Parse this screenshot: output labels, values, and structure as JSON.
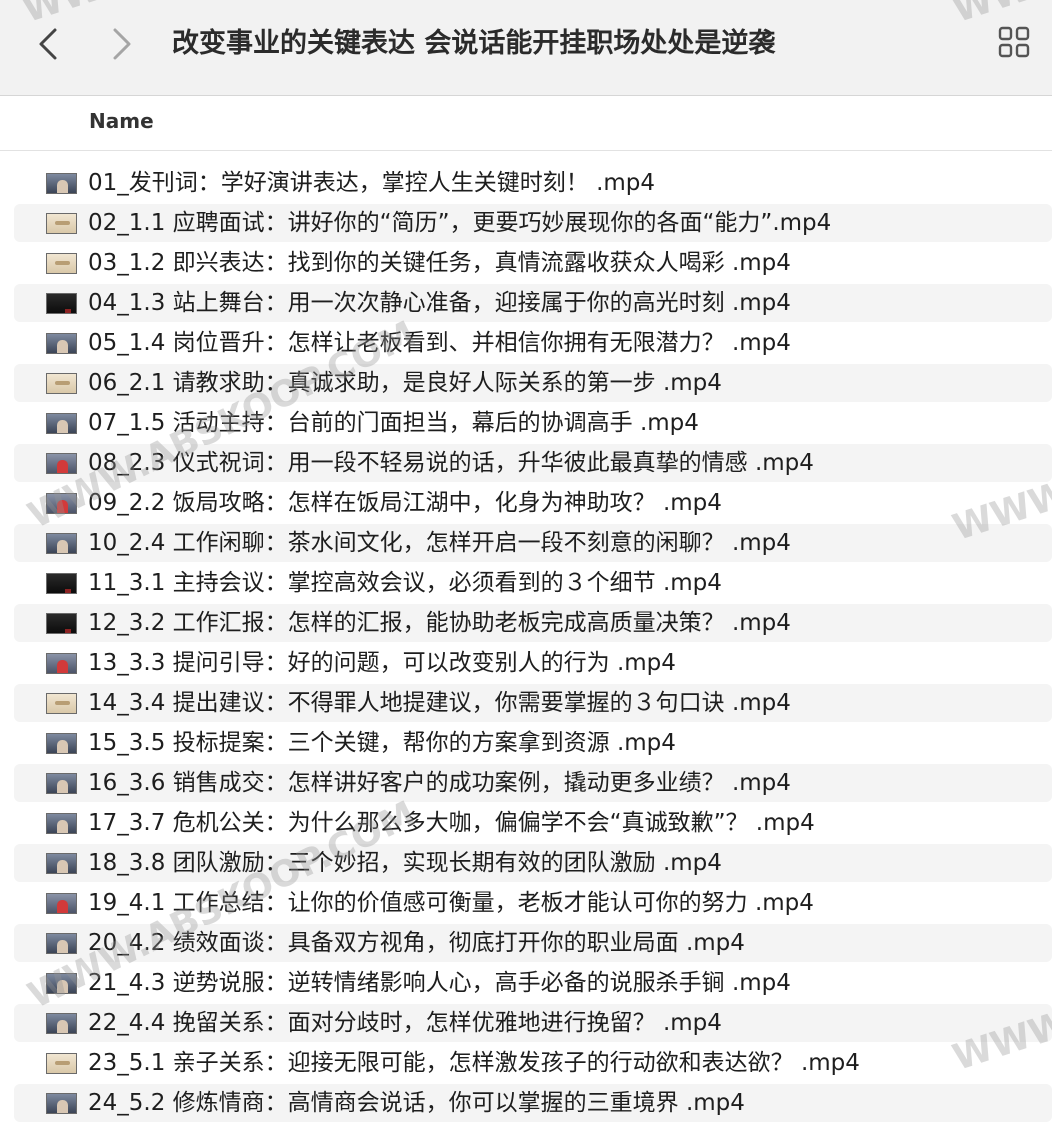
{
  "window": {
    "title": "改变事业的关键表达 会说话能开挂职场处处是逆袭"
  },
  "icons": {
    "back": "chevron-left-icon",
    "forward": "chevron-right-icon",
    "view": "grid-view-icon"
  },
  "columns": {
    "name": "Name"
  },
  "files": [
    {
      "name": "01_发刊词：学好演讲表达，掌控人生关键时刻！ .mp4",
      "thumb": "person"
    },
    {
      "name": "02_1.1 应聘面试：讲好你的“简历”，更要巧妙展现你的各面“能力”.mp4",
      "thumb": "paper"
    },
    {
      "name": "03_1.2 即兴表达：找到你的关键任务，真情流露收获众人喝彩 .mp4",
      "thumb": "paper"
    },
    {
      "name": "04_1.3 站上舞台：用一次次静心准备，迎接属于你的高光时刻 .mp4",
      "thumb": "dark"
    },
    {
      "name": "05_1.4 岗位晋升：怎样让老板看到、并相信你拥有无限潜力？ .mp4",
      "thumb": "person"
    },
    {
      "name": "06_2.1 请教求助：真诚求助，是良好人际关系的第一步 .mp4",
      "thumb": "paper"
    },
    {
      "name": "07_1.5 活动主持：台前的门面担当，幕后的协调高手 .mp4",
      "thumb": "person"
    },
    {
      "name": "08_2.3 仪式祝词：用一段不轻易说的话，升华彼此最真挚的情感 .mp4",
      "thumb": "red"
    },
    {
      "name": "09_2.2 饭局攻略：怎样在饭局江湖中，化身为神助攻？ .mp4",
      "thumb": "red"
    },
    {
      "name": "10_2.4 工作闲聊：茶水间文化，怎样开启一段不刻意的闲聊？ .mp4",
      "thumb": "person"
    },
    {
      "name": "11_3.1 主持会议：掌控高效会议，必须看到的３个细节 .mp4",
      "thumb": "dark"
    },
    {
      "name": "12_3.2 工作汇报：怎样的汇报，能协助老板完成高质量决策？ .mp4",
      "thumb": "dark"
    },
    {
      "name": "13_3.3 提问引导：好的问题，可以改变别人的行为 .mp4",
      "thumb": "red"
    },
    {
      "name": "14_3.4 提出建议：不得罪人地提建议，你需要掌握的３句口诀 .mp4",
      "thumb": "paper"
    },
    {
      "name": "15_3.5 投标提案：三个关键，帮你的方案拿到资源 .mp4",
      "thumb": "person"
    },
    {
      "name": "16_3.6 销售成交：怎样讲好客户的成功案例，撬动更多业绩？ .mp4",
      "thumb": "person"
    },
    {
      "name": "17_3.7 危机公关：为什么那么多大咖，偏偏学不会“真诚致歉”？ .mp4",
      "thumb": "person"
    },
    {
      "name": "18_3.8 团队激励：三个妙招，实现长期有效的团队激励 .mp4",
      "thumb": "person"
    },
    {
      "name": "19_4.1 工作总结：让你的价值感可衡量，老板才能认可你的努力 .mp4",
      "thumb": "red"
    },
    {
      "name": "20_4.2 绩效面谈：具备双方视角，彻底打开你的职业局面 .mp4",
      "thumb": "person"
    },
    {
      "name": "21_4.3 逆势说服：逆转情绪影响人心，高手必备的说服杀手锏 .mp4",
      "thumb": "person"
    },
    {
      "name": "22_4.4 挽留关系：面对分歧时，怎样优雅地进行挽留？ .mp4",
      "thumb": "person"
    },
    {
      "name": "23_5.1 亲子关系：迎接无限可能，怎样激发孩子的行动欲和表达欲？ .mp4",
      "thumb": "paper"
    },
    {
      "name": "24_5.2 修炼情商：高情商会说话，你可以掌握的三重境界 .mp4",
      "thumb": "person"
    }
  ],
  "watermarks": [
    "WWW",
    "WWW",
    "WWW.ABSKOOP.COM",
    "WWW",
    "WWW.ABSKOOP.COM",
    "WWW"
  ],
  "colors": {
    "titlebar": "#f2f2f2",
    "alt_row": "#f4f4f4"
  }
}
